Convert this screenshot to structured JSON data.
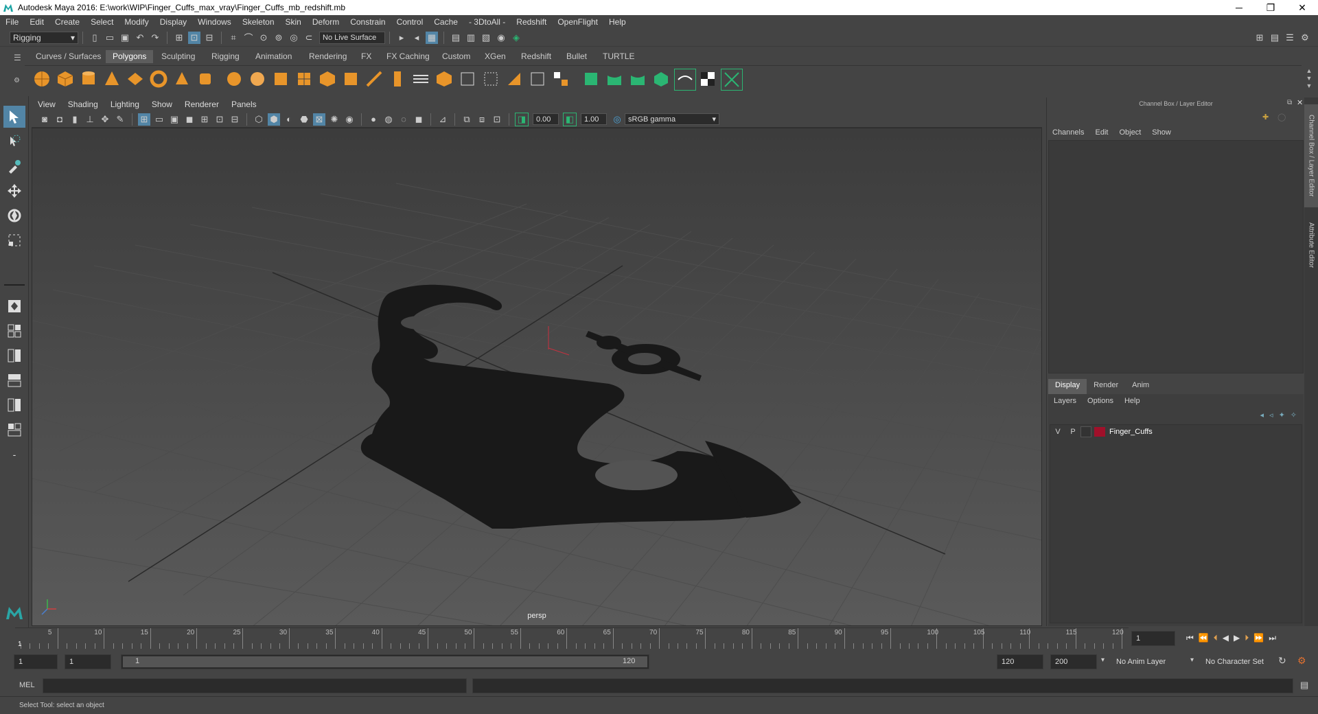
{
  "window": {
    "title": "Autodesk Maya 2016: E:\\work\\WIP\\Finger_Cuffs_max_vray\\Finger_Cuffs_mb_redshift.mb",
    "minimize": "─",
    "restore": "❐",
    "close": "✕"
  },
  "menubar": [
    "File",
    "Edit",
    "Create",
    "Select",
    "Modify",
    "Display",
    "Windows",
    "Skeleton",
    "Skin",
    "Deform",
    "Constrain",
    "Control",
    "Cache",
    "- 3DtoAll -",
    "Redshift",
    "OpenFlight",
    "Help"
  ],
  "statusline": {
    "mode": "Rigging",
    "live_surface": "No Live Surface"
  },
  "shelf_tabs": [
    "Curves / Surfaces",
    "Polygons",
    "Sculpting",
    "Rigging",
    "Animation",
    "Rendering",
    "FX",
    "FX Caching",
    "Custom",
    "XGen",
    "Redshift",
    "Bullet",
    "TURTLE"
  ],
  "shelf_active": "Polygons",
  "viewport": {
    "menu": [
      "View",
      "Shading",
      "Lighting",
      "Show",
      "Renderer",
      "Panels"
    ],
    "value_a": "0.00",
    "value_b": "1.00",
    "color_space": "sRGB gamma",
    "camera_label": "persp"
  },
  "channel_box": {
    "title": "Channel Box / Layer Editor",
    "menu": [
      "Channels",
      "Edit",
      "Object",
      "Show"
    ]
  },
  "layer_editor": {
    "tabs": [
      "Display",
      "Render",
      "Anim"
    ],
    "active_tab": "Display",
    "menu": [
      "Layers",
      "Options",
      "Help"
    ],
    "layers": [
      {
        "v": "V",
        "p": "P",
        "name": "Finger_Cuffs",
        "color": "#a0102a"
      }
    ]
  },
  "side_tabs": [
    "Channel Box / Layer Editor",
    "Attribute Editor"
  ],
  "timeline": {
    "ticks": [
      5,
      10,
      15,
      20,
      25,
      30,
      35,
      40,
      45,
      50,
      55,
      60,
      65,
      70,
      75,
      80,
      85,
      90,
      95,
      100,
      105,
      110,
      115,
      120
    ],
    "start_label": "1",
    "current_frame": "1"
  },
  "range": {
    "start_frame": "1",
    "playback_start": "1",
    "slider_start": "1",
    "slider_end": "120",
    "playback_end": "120",
    "end_frame": "200",
    "anim_layer": "No Anim Layer",
    "character_set": "No Character Set"
  },
  "command_line": {
    "label": "MEL"
  },
  "help_line": "Select Tool: select an object",
  "colors": {
    "accent": "#5285a6",
    "shelf_orange": "#e8952a",
    "shelf_green": "#2bb673",
    "layer_red": "#a0102a"
  }
}
